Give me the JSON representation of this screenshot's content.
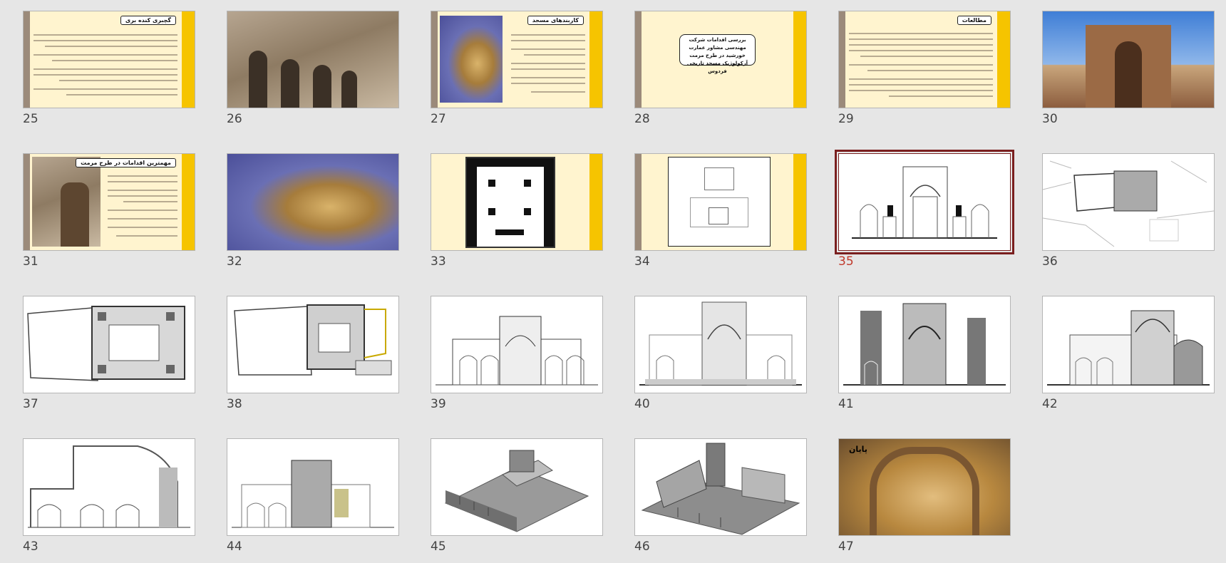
{
  "view": "slide-sorter",
  "selected_slide": "35",
  "colors": {
    "background": "#e6e6e6",
    "selection": "#7a1f1f",
    "selected_number": "#c0392b",
    "theme_background": "#fff4cf",
    "theme_accent": "#f6c400",
    "theme_side": "#9b8a7a"
  },
  "slides": [
    {
      "number": "25",
      "kind": "text",
      "title": "گچبری کنده بری"
    },
    {
      "number": "26",
      "kind": "photo"
    },
    {
      "number": "27",
      "kind": "text-photo",
      "title": "کاربندهای مسجد"
    },
    {
      "number": "28",
      "kind": "title",
      "title": "بررسی اقدامات شرکت مهندسی مشاور عمارت خورشید در طرح مرمت آرکولوژیک مسجد تاریخی فردوس"
    },
    {
      "number": "29",
      "kind": "text",
      "title": "مطالعات"
    },
    {
      "number": "30",
      "kind": "photo"
    },
    {
      "number": "31",
      "kind": "text-photo",
      "title": "مهمترین اقدامات در طرح مرمت"
    },
    {
      "number": "32",
      "kind": "photo"
    },
    {
      "number": "33",
      "kind": "plan"
    },
    {
      "number": "34",
      "kind": "plan"
    },
    {
      "number": "35",
      "kind": "drawing"
    },
    {
      "number": "36",
      "kind": "drawing"
    },
    {
      "number": "37",
      "kind": "drawing"
    },
    {
      "number": "38",
      "kind": "drawing"
    },
    {
      "number": "39",
      "kind": "drawing"
    },
    {
      "number": "40",
      "kind": "drawing"
    },
    {
      "number": "41",
      "kind": "drawing"
    },
    {
      "number": "42",
      "kind": "drawing"
    },
    {
      "number": "43",
      "kind": "drawing"
    },
    {
      "number": "44",
      "kind": "drawing"
    },
    {
      "number": "45",
      "kind": "model"
    },
    {
      "number": "46",
      "kind": "model"
    },
    {
      "number": "47",
      "kind": "photo",
      "title": "پایان"
    }
  ]
}
